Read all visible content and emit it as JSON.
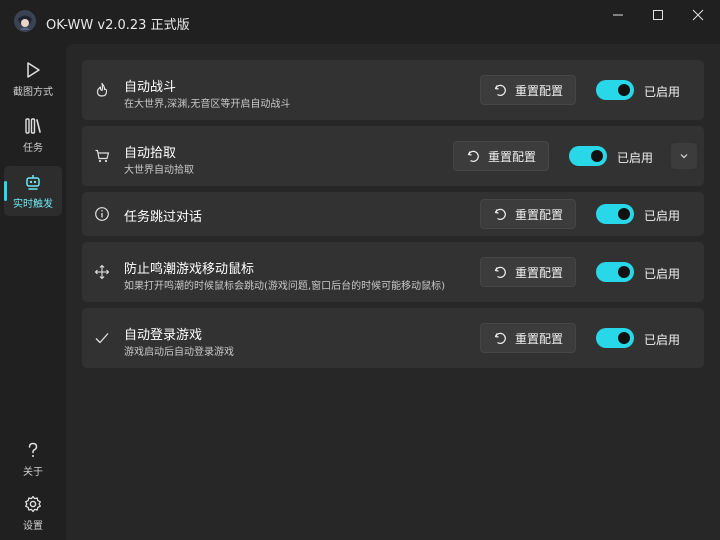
{
  "window": {
    "title": "OK-WW v2.0.23 正式版",
    "controls": {
      "minimize": "minimize",
      "maximize": "maximize",
      "close": "close"
    }
  },
  "sidebar": {
    "items": [
      {
        "label": "截图方式",
        "icon": "play-icon",
        "active": false
      },
      {
        "label": "任务",
        "icon": "tasks-icon",
        "active": false
      },
      {
        "label": "实时触发",
        "icon": "robot-icon",
        "active": true
      }
    ],
    "bottom_items": [
      {
        "label": "关于",
        "icon": "help-icon"
      },
      {
        "label": "设置",
        "icon": "gear-icon"
      }
    ]
  },
  "tasks": [
    {
      "title": "自动战斗",
      "description": "在大世界,深渊,无音区等开启自动战斗",
      "icon": "fire-icon",
      "reset_label": "重置配置",
      "enabled": true,
      "status_label": "已启用"
    },
    {
      "title": "自动拾取",
      "description": "大世界自动拾取",
      "icon": "cart-icon",
      "reset_label": "重置配置",
      "enabled": true,
      "status_label": "已启用",
      "expandable": true
    },
    {
      "title": "任务跳过对话",
      "description": "",
      "icon": "info-icon",
      "reset_label": "重置配置",
      "enabled": true,
      "status_label": "已启用"
    },
    {
      "title": "防止鸣潮游戏移动鼠标",
      "description": "如果打开鸣潮的时候鼠标会跳动(游戏问题,窗口后台的时候可能移动鼠标)",
      "icon": "move-icon",
      "reset_label": "重置配置",
      "enabled": true,
      "status_label": "已启用"
    },
    {
      "title": "自动登录游戏",
      "description": "游戏启动后自动登录游戏",
      "icon": "check-icon",
      "reset_label": "重置配置",
      "enabled": true,
      "status_label": "已启用"
    }
  ],
  "colors": {
    "accent": "#28d8e8",
    "background": "#202020",
    "card": "#323232"
  }
}
